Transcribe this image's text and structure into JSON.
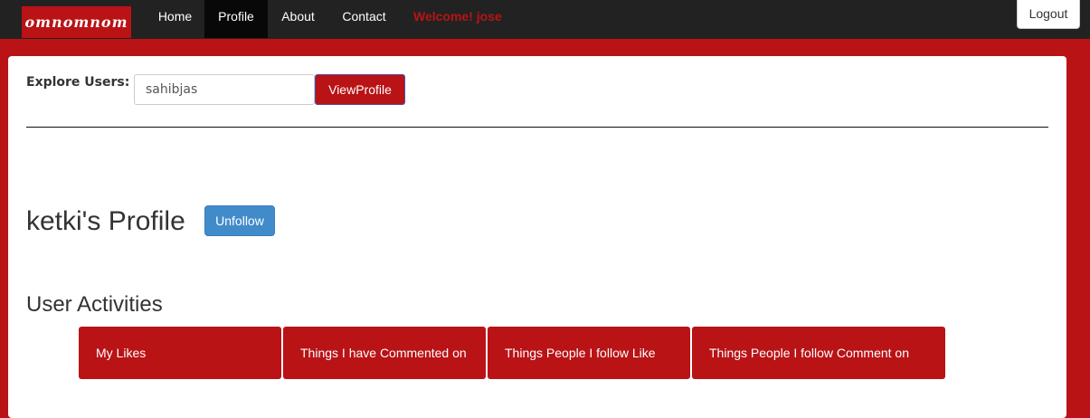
{
  "navbar": {
    "brand": "omnomnom",
    "items": [
      {
        "label": "Home"
      },
      {
        "label": "Profile"
      },
      {
        "label": "About"
      },
      {
        "label": "Contact"
      }
    ],
    "welcome": "Welcome! jose",
    "logout_label": "Logout"
  },
  "explore": {
    "label": "Explore Users:",
    "input_value": "sahibjas",
    "button_label": "ViewProfile"
  },
  "profile": {
    "title": "ketki's Profile",
    "unfollow_label": "Unfollow"
  },
  "activities": {
    "title": "User Activities",
    "tabs": [
      {
        "label": "My Likes"
      },
      {
        "label": "Things I have Commented on"
      },
      {
        "label": "Things People I follow Like"
      },
      {
        "label": "Things People I follow Comment on"
      }
    ]
  },
  "colors": {
    "brand_red": "#b91316",
    "navbar_bg": "#222222",
    "unfollow_blue": "#428bca"
  }
}
